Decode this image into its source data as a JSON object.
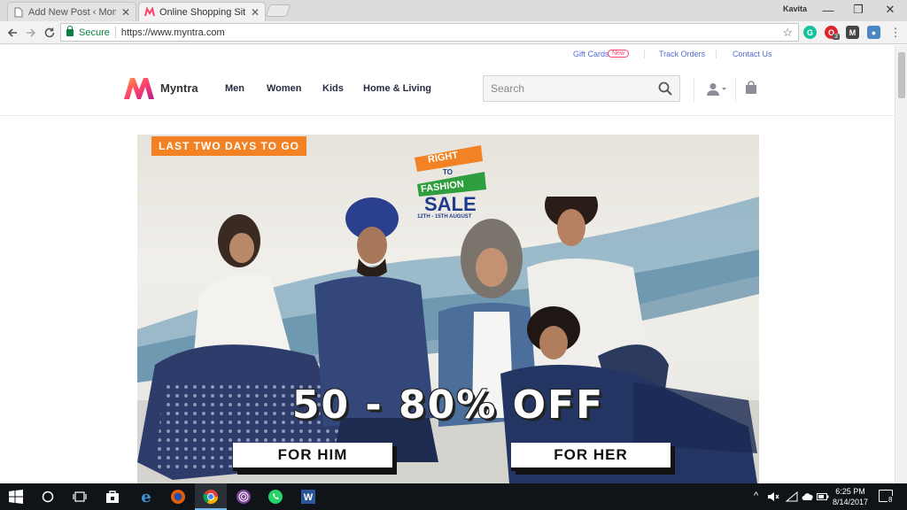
{
  "browser": {
    "tabs": [
      {
        "title": "Add New Post ‹ Momtast",
        "active": false
      },
      {
        "title": "Online Shopping Site - S",
        "active": true
      }
    ],
    "profile_name": "Kavita",
    "window_controls": {
      "minimize": "—",
      "restore": "❐",
      "close": "✕"
    },
    "security_label": "Secure",
    "url": "https://www.myntra.com",
    "ext_badge_count": "3"
  },
  "page": {
    "top_links": {
      "gift_cards": "Gift Cards",
      "new_badge": "New",
      "track_orders": "Track Orders",
      "contact_us": "Contact Us"
    },
    "brand": "Myntra",
    "nav": [
      "Men",
      "Women",
      "Kids",
      "Home & Living"
    ],
    "search_placeholder": "Search",
    "banner": {
      "tag": "LAST TWO DAYS TO GO",
      "sale_line1": "RIGHT",
      "sale_line2": "TO",
      "sale_line3": "FASHION",
      "sale_line4": "SALE",
      "sale_dates": "12TH - 15TH AUGUST",
      "offer": "50 - 80% OFF",
      "cta_him": "FOR HIM",
      "cta_her": "FOR HER"
    }
  },
  "taskbar": {
    "time": "6:25 PM",
    "date": "8/14/2017",
    "notification_count": "8"
  },
  "colors": {
    "brand_pink": "#ff3f6c",
    "brand_orange": "#f28224",
    "link_blue": "#526cd0",
    "secure_green": "#0b8043"
  }
}
